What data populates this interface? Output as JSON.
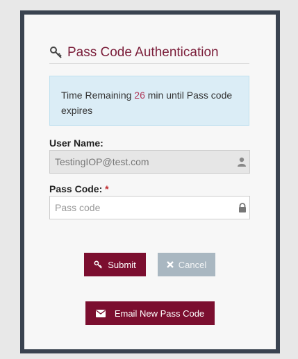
{
  "header": {
    "title": "Pass Code Authentication"
  },
  "alert": {
    "prefix": "Time Remaining",
    "minutes": "26",
    "suffix": "min until Pass code expires"
  },
  "form": {
    "username_label": "User Name:",
    "username_value": "TestingIOP@test.com",
    "passcode_label": "Pass Code:",
    "passcode_required_mark": "*",
    "passcode_placeholder": "Pass code"
  },
  "buttons": {
    "submit_label": "Submit",
    "cancel_label": "Cancel",
    "email_label": "Email New Pass Code"
  },
  "icons": {
    "title": "key-icon",
    "username": "user-icon",
    "passcode": "lock-icon",
    "submit": "key-icon",
    "cancel": "close-icon",
    "email": "envelope-icon"
  },
  "colors": {
    "accent": "#7b0e2f",
    "frame_border": "#3a4350",
    "alert_bg": "#dbedf6",
    "cancel_bg": "#a9b7c1",
    "required": "#c0282d"
  }
}
